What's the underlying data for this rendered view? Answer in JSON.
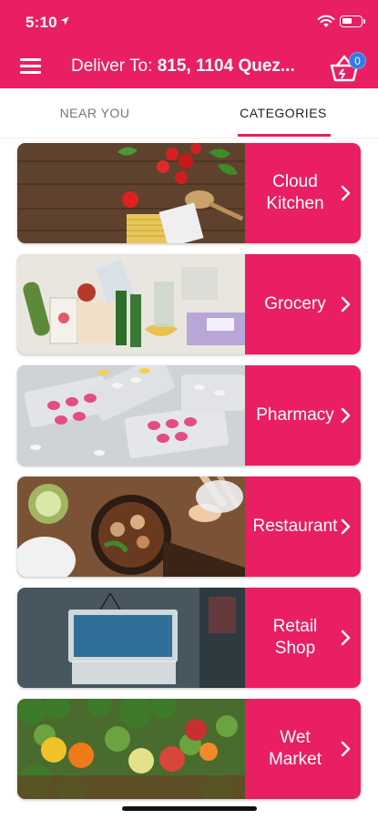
{
  "status": {
    "time": "5:10"
  },
  "header": {
    "deliver_prefix": "Deliver To: ",
    "deliver_address": "815, 1104 Quez...",
    "cart_count": "0",
    "brand_color": "#e91e63",
    "badge_color": "#2f7be8"
  },
  "tabs": {
    "near_you": "NEAR YOU",
    "categories": "CATEGORIES"
  },
  "categories": [
    {
      "label": "Cloud\nKitchen"
    },
    {
      "label": "Grocery"
    },
    {
      "label": "Pharmacy"
    },
    {
      "label": "Restaurant"
    },
    {
      "label": "Retail\nShop"
    },
    {
      "label": "Wet\nMarket"
    }
  ]
}
